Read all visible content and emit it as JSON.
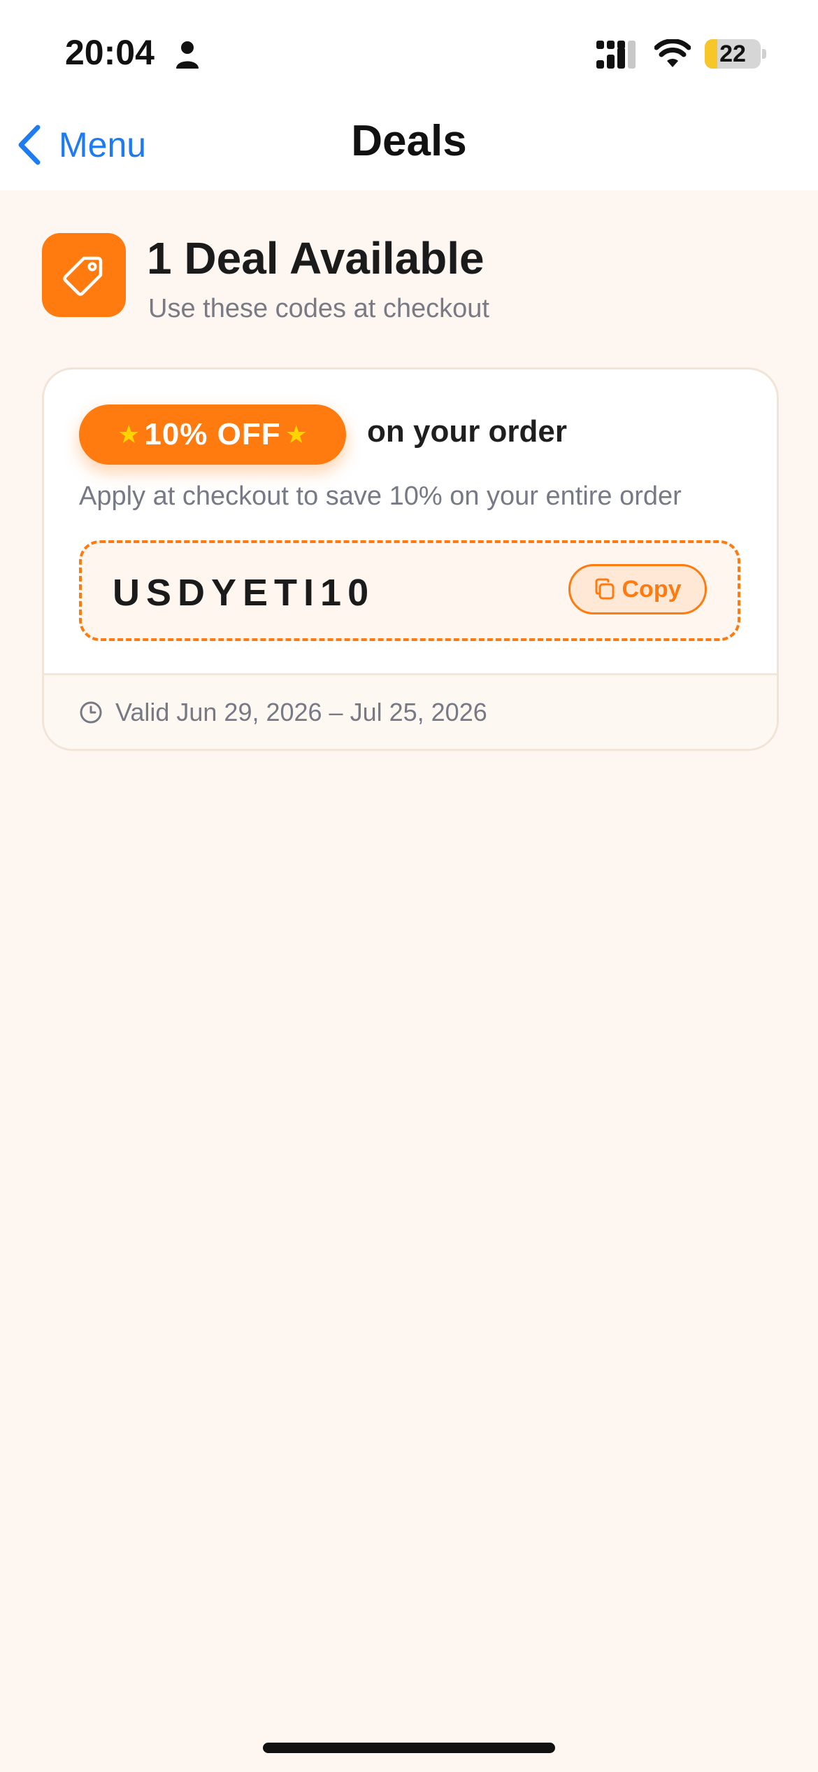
{
  "status_bar": {
    "time": "20:04",
    "battery_level": "22"
  },
  "nav": {
    "back_label": "Menu",
    "title": "Deals"
  },
  "header": {
    "icon": "tag-icon",
    "count_label": "1 Deal Available",
    "subtitle": "Use these codes at checkout"
  },
  "deals": [
    {
      "badge_label": "10% OFF",
      "badge_suffix": "on your order",
      "description": "Apply at checkout to save 10% on your entire order",
      "code": "USDYETI10",
      "copy_label": "Copy",
      "validity": "Valid Jun 29, 2026 – Jul 25, 2026"
    }
  ],
  "colors": {
    "accent": "#FF7A0F",
    "link": "#1F7CF0",
    "background": "#FEF6F0",
    "star": "#FFD400"
  }
}
